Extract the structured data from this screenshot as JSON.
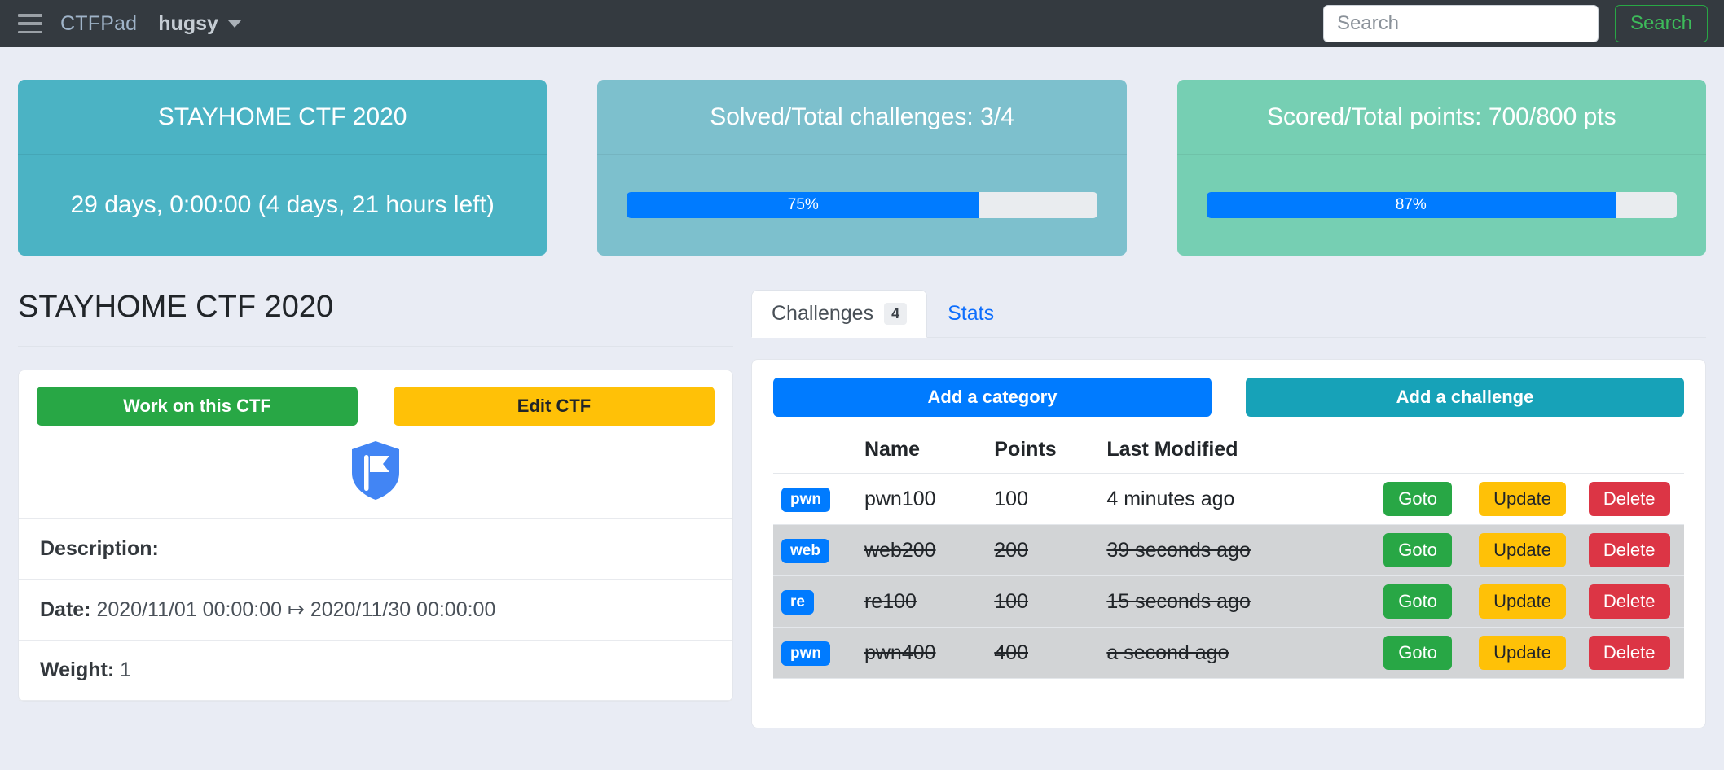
{
  "navbar": {
    "menu_icon": "hamburger-icon",
    "brand": "CTFPad",
    "user": "hugsy",
    "caret_icon": "chevron-down-icon",
    "search_placeholder": "Search",
    "search_value": "",
    "search_button": "Search"
  },
  "stat_cards": [
    {
      "header": "STAYHOME CTF 2020",
      "body": "29 days, 0:00:00 (4 days, 21 hours left)",
      "color": "#4bb3c4",
      "has_progress": false
    },
    {
      "header": "Solved/Total challenges: 3/4",
      "color": "#7dc0cd",
      "has_progress": true,
      "progress_label": "75%",
      "progress_percent": 75
    },
    {
      "header": "Scored/Total points: 700/800 pts",
      "color": "#76cfb3",
      "has_progress": true,
      "progress_label": "87%",
      "progress_percent": 87
    }
  ],
  "left": {
    "page_title": "STAYHOME CTF 2020",
    "work_button": "Work on this CTF",
    "edit_button": "Edit CTF",
    "logo_icon": "shield-flag-icon",
    "description_label": "Description:",
    "description_value": "",
    "date_label": "Date:",
    "date_value": "2020/11/01 00:00:00 ↦ 2020/11/30 00:00:00",
    "weight_label": "Weight:",
    "weight_value": "1"
  },
  "tabs": [
    {
      "label": "Challenges",
      "badge": "4",
      "active": true
    },
    {
      "label": "Stats",
      "badge": "",
      "active": false
    }
  ],
  "challenges": {
    "add_category_button": "Add a category",
    "add_challenge_button": "Add a challenge",
    "columns": [
      "",
      "Name",
      "Points",
      "Last Modified",
      "",
      "",
      ""
    ],
    "actions": {
      "goto": "Goto",
      "update": "Update",
      "delete": "Delete"
    },
    "rows": [
      {
        "category": "pwn",
        "name": "pwn100",
        "points": "100",
        "last_modified": "4 minutes ago",
        "solved": false
      },
      {
        "category": "web",
        "name": "web200",
        "points": "200",
        "last_modified": "39 seconds ago",
        "solved": true
      },
      {
        "category": "re",
        "name": "re100",
        "points": "100",
        "last_modified": "15 seconds ago",
        "solved": true
      },
      {
        "category": "pwn",
        "name": "pwn400",
        "points": "400",
        "last_modified": "a second ago",
        "solved": true
      }
    ]
  },
  "colors": {
    "navbar": "#343a40",
    "page_background": "#e9ecf4",
    "primary": "#007bff",
    "success": "#28a745",
    "warning": "#ffc107",
    "danger": "#dc3545",
    "info": "#17a2b8"
  }
}
